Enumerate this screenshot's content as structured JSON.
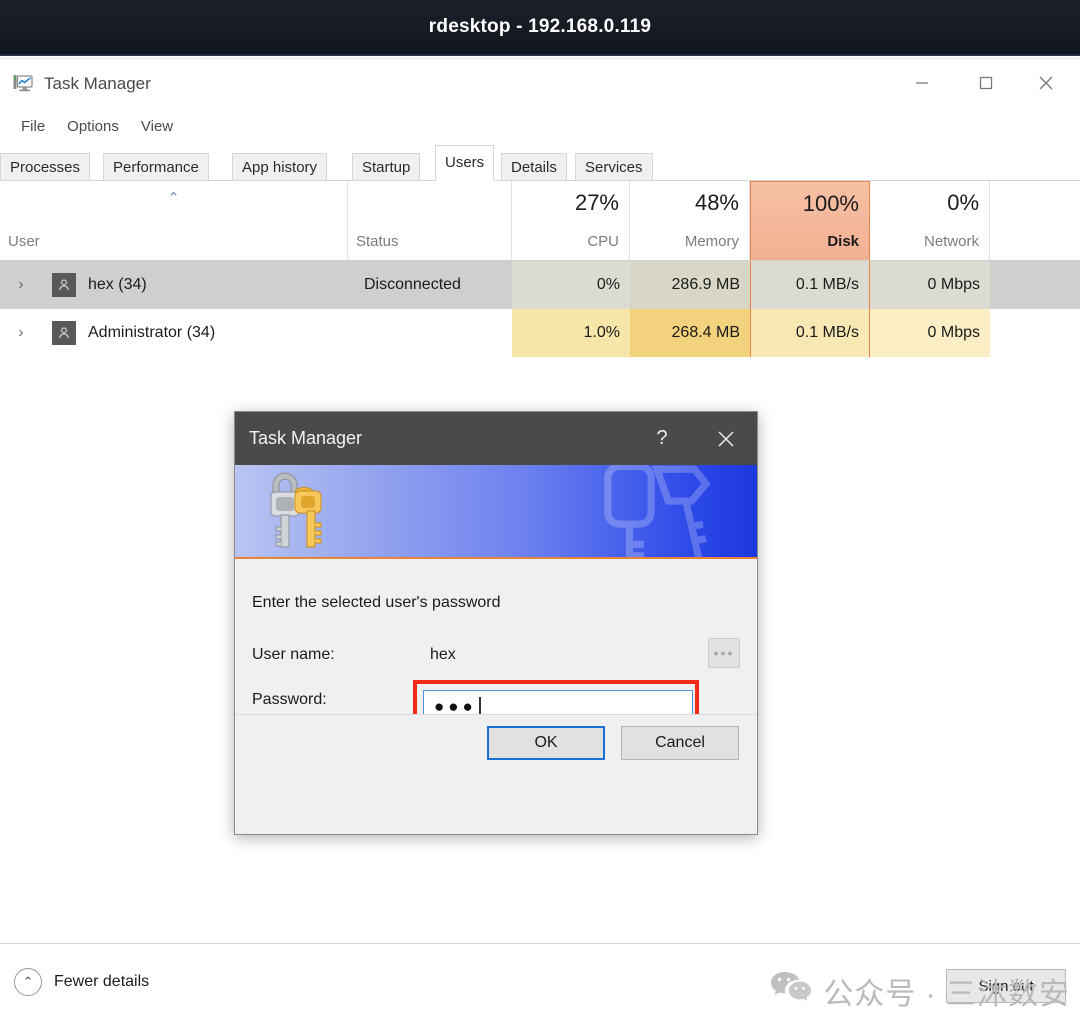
{
  "rdesktop": {
    "title": "rdesktop - 192.168.0.119"
  },
  "taskmanager": {
    "title": "Task Manager",
    "app_icon": "task-manager-monitor-icon",
    "window_controls": {
      "minimize": "─",
      "maximize": "☐",
      "close": "✕"
    },
    "menu": [
      {
        "label": "File"
      },
      {
        "label": "Options"
      },
      {
        "label": "View"
      }
    ],
    "tabs": [
      {
        "label": "Processes",
        "active": false
      },
      {
        "label": "Performance",
        "active": false
      },
      {
        "label": "App history",
        "active": false
      },
      {
        "label": "Startup",
        "active": false
      },
      {
        "label": "Users",
        "active": true
      },
      {
        "label": "Details",
        "active": false
      },
      {
        "label": "Services",
        "active": false
      }
    ],
    "table": {
      "sort_indicator": "⌃",
      "columns": [
        {
          "name": "User",
          "percent": "",
          "type": "textual"
        },
        {
          "name": "Status",
          "percent": "",
          "type": "textual"
        },
        {
          "name": "CPU",
          "percent": "27%",
          "type": "numeric"
        },
        {
          "name": "Memory",
          "percent": "48%",
          "type": "numeric"
        },
        {
          "name": "Disk",
          "percent": "100%",
          "type": "numeric"
        },
        {
          "name": "Network",
          "percent": "0%",
          "type": "numeric"
        }
      ],
      "rows": [
        {
          "expander": "›",
          "avatar": "user-avatar-icon",
          "user": "hex (34)",
          "status": "Disconnected",
          "cpu": "0%",
          "memory": "286.9 MB",
          "disk": "0.1 MB/s",
          "network": "0 Mbps",
          "selected": true
        },
        {
          "expander": "›",
          "avatar": "user-avatar-icon",
          "user": "Administrator (34)",
          "status": "",
          "cpu": "1.0%",
          "memory": "268.4 MB",
          "disk": "0.1 MB/s",
          "network": "0 Mbps",
          "selected": false
        }
      ]
    },
    "statusbar": {
      "fewer_details_icon": "⌃",
      "fewer_details_label": "Fewer details",
      "signout_label": "Sign out"
    }
  },
  "dialog": {
    "title": "Task Manager",
    "help_glyph": "?",
    "close_glyph": "✕",
    "banner_icon": "keys-icon",
    "prompt": "Enter the selected user's password",
    "username_label": "User name:",
    "username_value": "hex",
    "browse_label": "•••",
    "password_label": "Password:",
    "password_value": "●●●",
    "ok_label": "OK",
    "cancel_label": "Cancel"
  },
  "watermark": {
    "icon": "wechat-icon",
    "text": "公众号 · 三沐数安"
  },
  "colors": {
    "rdesktop_titlebar": "#171b24",
    "dialog_titlebar": "#4a4a48",
    "banner_blue": "#2b48e8",
    "banner_accent": "#e3853c",
    "hot_column": "#f2b093",
    "hot_border": "#e8834c",
    "selected_row": "#cfcfcf",
    "highlight_red": "#f22a18",
    "focus_blue": "#1a6fd4",
    "memory_warm": "#f2d27c",
    "cpu_warm": "#f6e6a8",
    "network_warm": "#fbeec4"
  }
}
